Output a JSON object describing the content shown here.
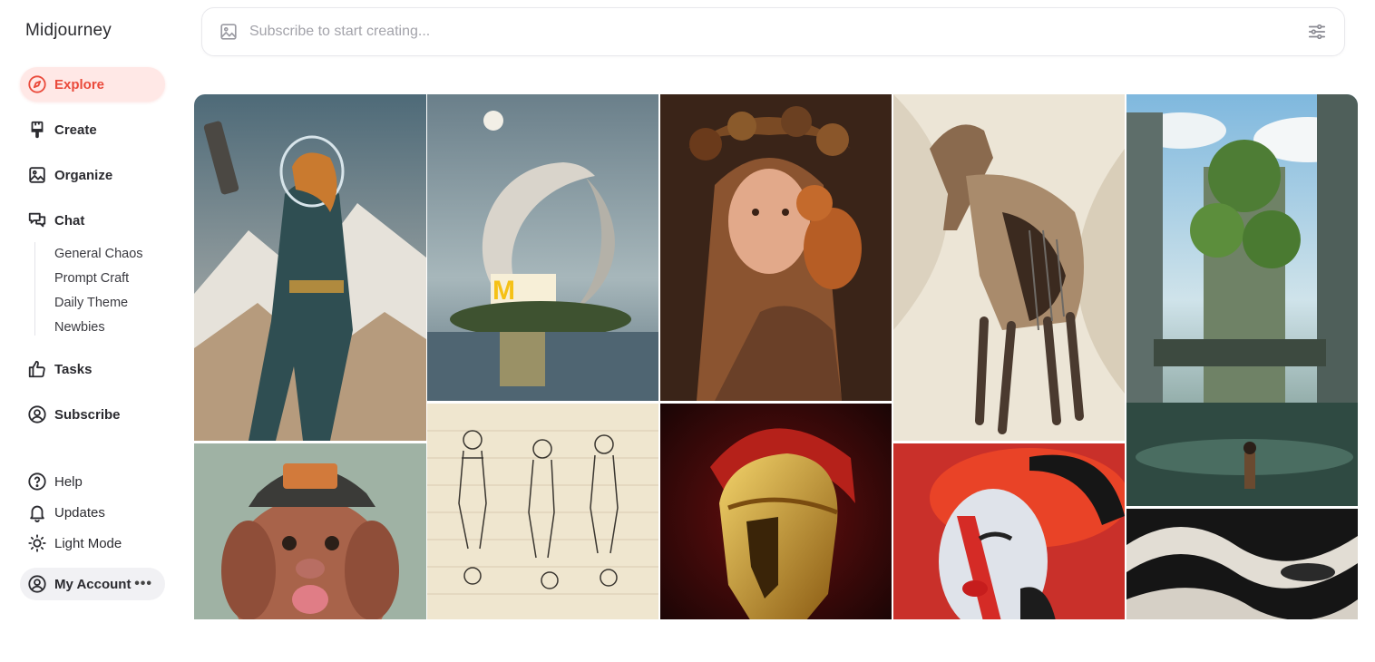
{
  "app": {
    "brand": "Midjourney"
  },
  "sidebar": {
    "nav": [
      {
        "label": "Explore",
        "icon": "compass-icon",
        "active": true
      },
      {
        "label": "Create",
        "icon": "brush-icon"
      },
      {
        "label": "Organize",
        "icon": "image-icon"
      },
      {
        "label": "Chat",
        "icon": "chat-icon"
      }
    ],
    "chat_rooms": [
      "General Chaos",
      "Prompt Craft",
      "Daily Theme",
      "Newbies"
    ],
    "nav2": [
      {
        "label": "Tasks",
        "icon": "thumbs-up-icon"
      },
      {
        "label": "Subscribe",
        "icon": "user-circle-icon"
      }
    ],
    "footer": [
      {
        "label": "Help",
        "icon": "help-icon"
      },
      {
        "label": "Updates",
        "icon": "bell-icon"
      },
      {
        "label": "Light Mode",
        "icon": "sun-icon"
      }
    ],
    "account": {
      "label": "My Account",
      "icon": "user-circle-icon",
      "menu_icon": "more-dots-icon",
      "dots": "•••"
    }
  },
  "search": {
    "placeholder": "Subscribe to start creating...",
    "value": "",
    "icon": "image-icon",
    "filter_icon": "sliders-icon"
  },
  "colors": {
    "accent": "#ea4a3b",
    "active_bg": "#ffe8e6",
    "text": "#2b2b30",
    "muted": "#a3a3aa"
  },
  "gallery": {
    "tiles": [
      "astronaut-woman-image",
      "moon-restaurant-image",
      "girl-with-squirrel-image",
      "abstract-horse-image",
      "overgrown-city-image",
      "dog-with-cap-image",
      "sketch-figures-image",
      "golden-helmet-image",
      "red-hat-woman-image",
      "abstract-swirl-image"
    ]
  }
}
